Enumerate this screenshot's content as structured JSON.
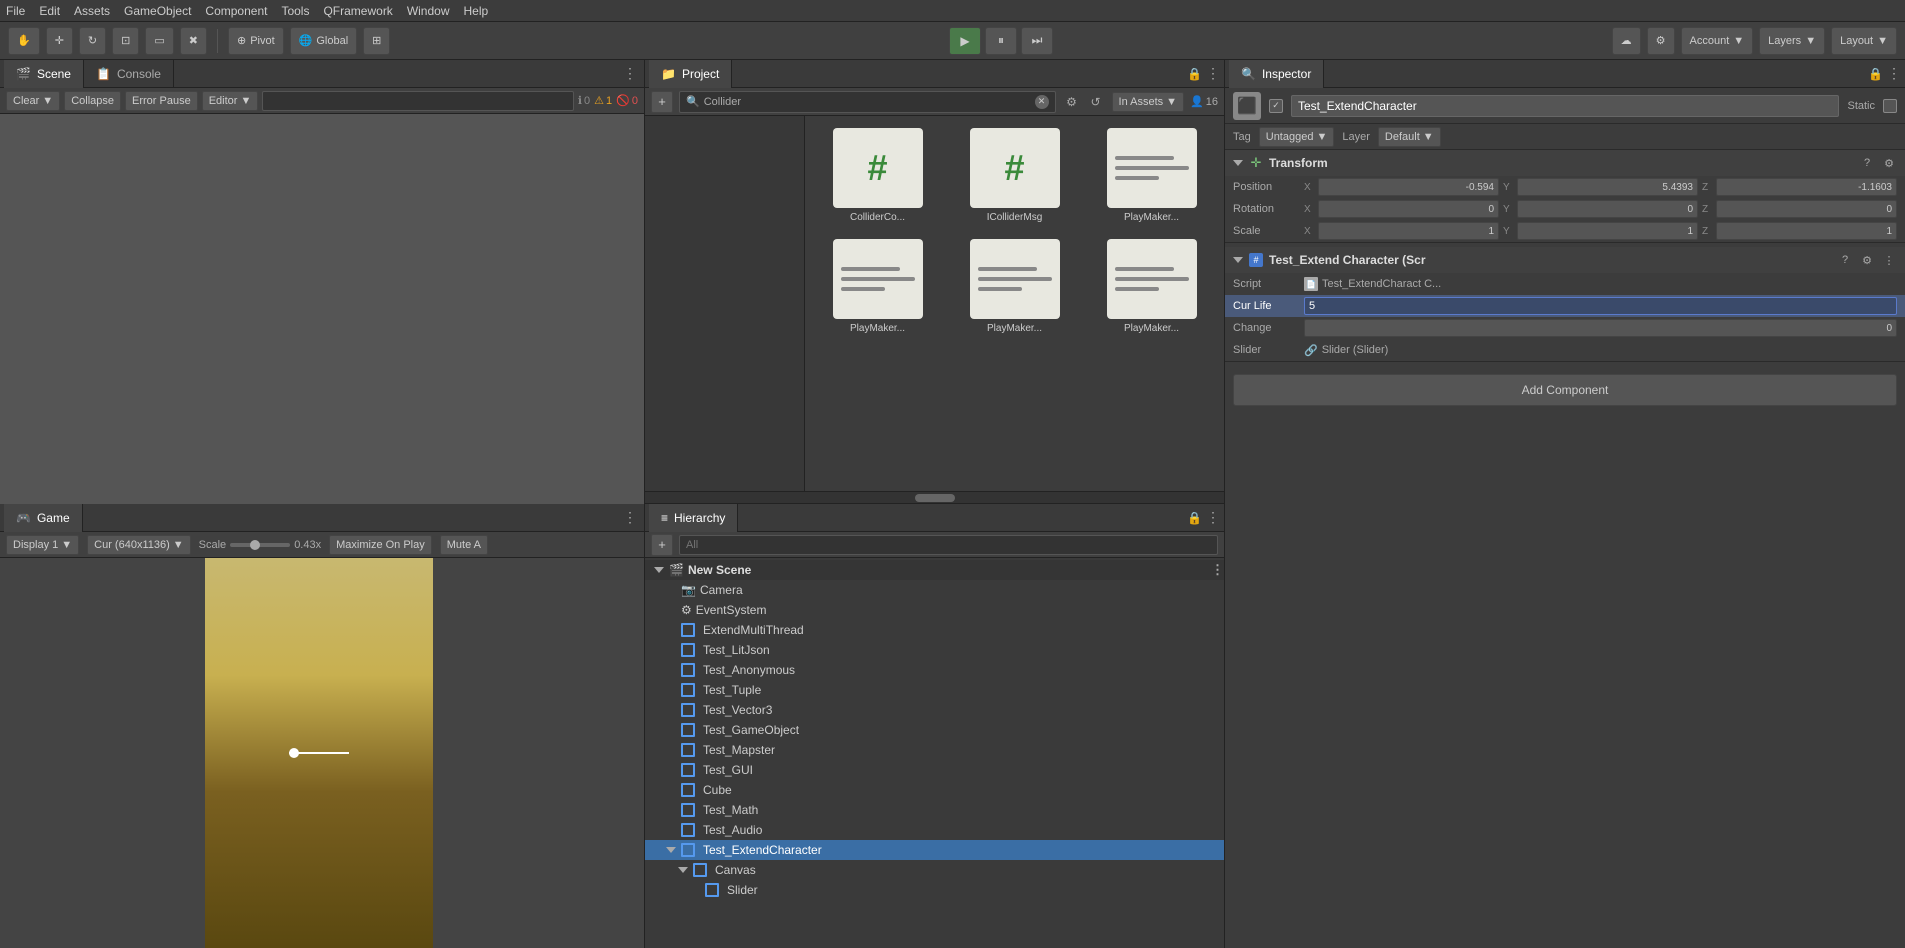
{
  "menubar": {
    "items": [
      "File",
      "Edit",
      "Assets",
      "GameObject",
      "Component",
      "Tools",
      "QFramework",
      "Window",
      "Help"
    ]
  },
  "toolbar": {
    "pivot_label": "Pivot",
    "global_label": "Global",
    "account_label": "Account",
    "layers_label": "Layers",
    "layout_label": "Layout"
  },
  "scene_panel": {
    "tab_label": "Scene",
    "console_tab": "Console",
    "clear_btn": "Clear",
    "collapse_btn": "Collapse",
    "error_pause_btn": "Error Pause",
    "editor_btn": "Editor",
    "search_placeholder": "",
    "badge_0": "0",
    "badge_warn": "1",
    "badge_err": "0"
  },
  "game_panel": {
    "tab_label": "Game",
    "display_label": "Display 1",
    "resolution_label": "Cur (640x1136)",
    "scale_label": "Scale",
    "scale_value": "0.43x",
    "maximize_btn": "Maximize On Play",
    "mute_btn": "Mute A"
  },
  "project_panel": {
    "tab_label": "Project",
    "search_text": "Collider",
    "in_assets_label": "In Assets",
    "count_label": "16",
    "assets": [
      {
        "name": "ColliderCo...",
        "type": "hash"
      },
      {
        "name": "IColliderMsg",
        "type": "hash"
      },
      {
        "name": "PlayMaker...",
        "type": "script"
      },
      {
        "name": "PlayMaker...",
        "type": "script"
      },
      {
        "name": "PlayMaker...",
        "type": "script"
      },
      {
        "name": "PlayMaker...",
        "type": "script"
      }
    ]
  },
  "hierarchy_panel": {
    "tab_label": "Hierarchy",
    "scene_name": "New Scene",
    "items": [
      {
        "name": "Camera",
        "indent": 1,
        "type": "cube"
      },
      {
        "name": "EventSystem",
        "indent": 1,
        "type": "cube"
      },
      {
        "name": "ExtendMultiThread",
        "indent": 1,
        "type": "cube"
      },
      {
        "name": "Test_LitJson",
        "indent": 1,
        "type": "cube"
      },
      {
        "name": "Test_Anonymous",
        "indent": 1,
        "type": "cube"
      },
      {
        "name": "Test_Tuple",
        "indent": 1,
        "type": "cube"
      },
      {
        "name": "Test_Vector3",
        "indent": 1,
        "type": "cube"
      },
      {
        "name": "Test_GameObject",
        "indent": 1,
        "type": "cube"
      },
      {
        "name": "Test_Mapster",
        "indent": 1,
        "type": "cube"
      },
      {
        "name": "Test_GUI",
        "indent": 1,
        "type": "cube"
      },
      {
        "name": "Cube",
        "indent": 1,
        "type": "cube"
      },
      {
        "name": "Test_Math",
        "indent": 1,
        "type": "cube"
      },
      {
        "name": "Test_Audio",
        "indent": 1,
        "type": "cube"
      },
      {
        "name": "Test_ExtendCharacter",
        "indent": 1,
        "type": "cube",
        "expanded": true,
        "selected": true
      },
      {
        "name": "Canvas",
        "indent": 2,
        "type": "cube",
        "expanded": true
      },
      {
        "name": "Slider",
        "indent": 3,
        "type": "cube"
      }
    ]
  },
  "inspector": {
    "tab_label": "Inspector",
    "object_name": "Test_ExtendCharacter",
    "static_label": "Static",
    "tag_label": "Tag",
    "tag_value": "Untagged",
    "layer_label": "Layer",
    "layer_value": "Default",
    "transform": {
      "title": "Transform",
      "position_label": "Position",
      "pos_x": "-0.594",
      "pos_y": "5.4393",
      "pos_z": "-1.1603",
      "rotation_label": "Rotation",
      "rot_x": "0",
      "rot_y": "0",
      "rot_z": "0",
      "scale_label": "Scale",
      "scale_x": "1",
      "scale_y": "1",
      "scale_z": "1"
    },
    "script_component": {
      "title": "Test_Extend Character (Scr",
      "script_label": "Script",
      "script_value": "Test_ExtendCharact C...",
      "cur_life_label": "Cur Life",
      "cur_life_value": "5",
      "change_label": "Change",
      "change_value": "0",
      "slider_label": "Slider",
      "slider_value": "Slider (Slider)"
    },
    "add_component_btn": "Add Component"
  }
}
